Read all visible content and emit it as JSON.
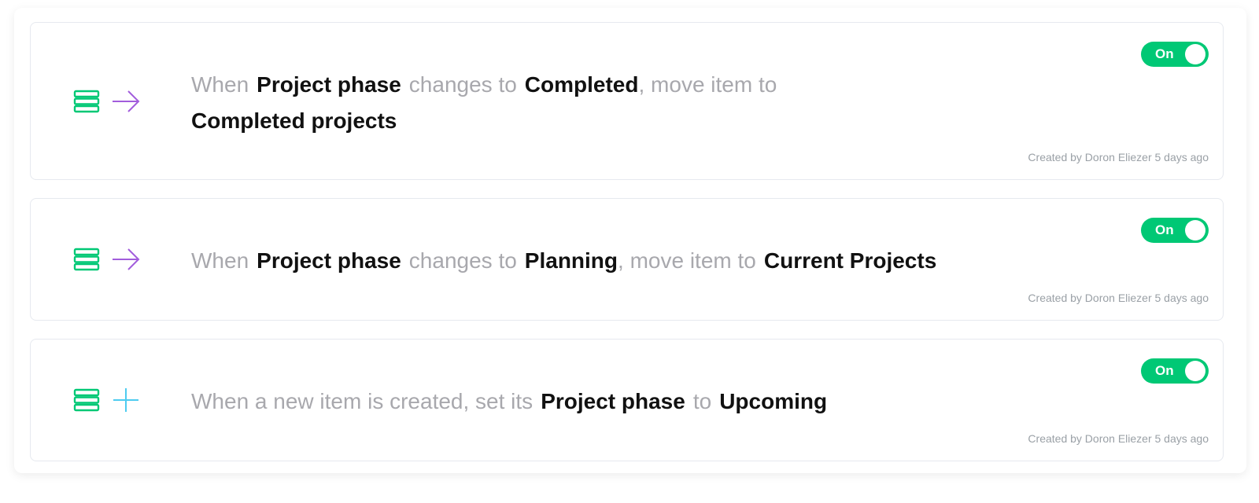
{
  "colors": {
    "toggle_on": "#00c875",
    "board_icon": "#00c875",
    "arrow_icon": "#a25ddc",
    "plus_icon": "#4eccf0"
  },
  "automations": [
    {
      "icons": [
        "board-icon",
        "arrow-right-icon"
      ],
      "sentence": {
        "p1": "When",
        "b1": "Project phase",
        "p2": "changes to",
        "b2": "Completed",
        "p3": ", move item to",
        "b3": "Completed projects"
      },
      "toggle_label": "On",
      "created_by": "Created by Doron Eliezer 5 days ago"
    },
    {
      "icons": [
        "board-icon",
        "arrow-right-icon"
      ],
      "sentence": {
        "p1": "When",
        "b1": "Project phase",
        "p2": "changes to",
        "b2": "Planning",
        "p3": ", move item to",
        "b3": "Current Projects"
      },
      "toggle_label": "On",
      "created_by": "Created by Doron Eliezer 5 days ago"
    },
    {
      "icons": [
        "board-icon",
        "plus-icon"
      ],
      "sentence": {
        "p1": "When a new item is created, set its",
        "b1": "Project phase",
        "p2": "to",
        "b2": "Upcoming"
      },
      "toggle_label": "On",
      "created_by": "Created by Doron Eliezer 5 days ago"
    }
  ]
}
